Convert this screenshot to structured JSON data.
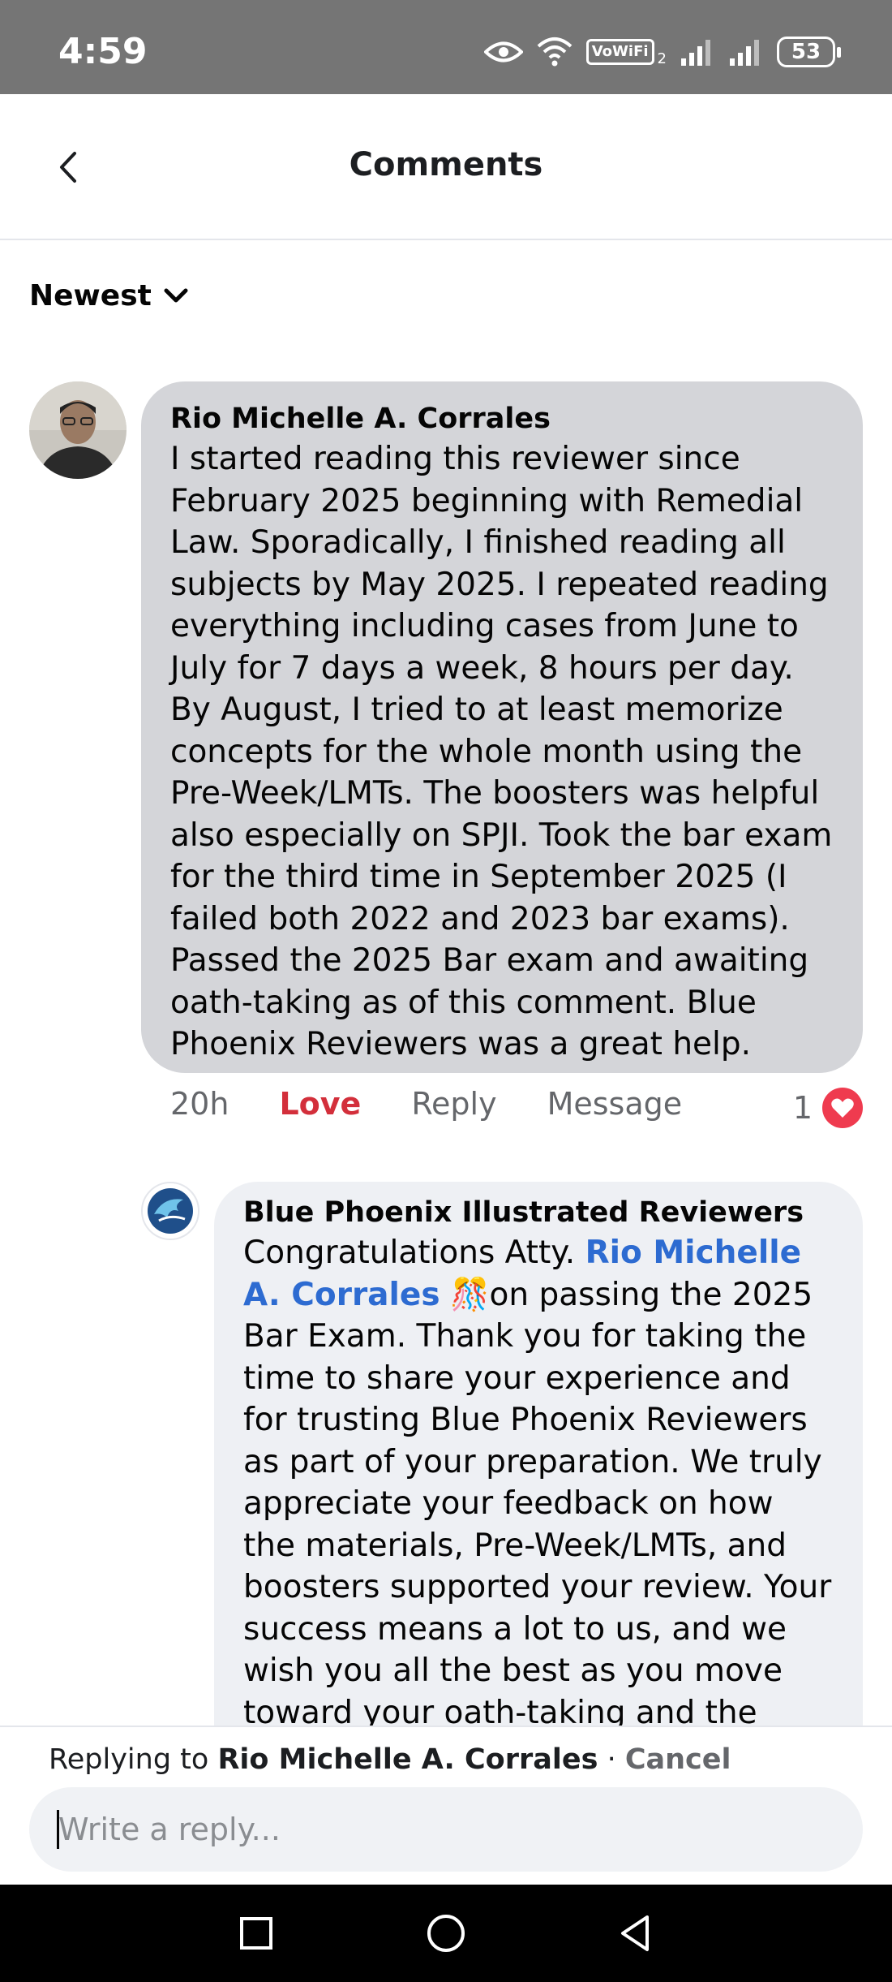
{
  "status_bar": {
    "time": "4:59",
    "vowifi": "VoWiFi",
    "vowifi_sub": "2",
    "battery": "53"
  },
  "header": {
    "title": "Comments"
  },
  "sort": {
    "label": "Newest"
  },
  "comments": [
    {
      "author": "Rio Michelle A. Corrales",
      "text": "I started reading this reviewer since February 2025 beginning with Remedial Law. Sporadically, I finished reading all subjects by May 2025. I repeated reading everything including cases from June to July for 7 days a week, 8 hours per day. By August, I tried to at least memorize concepts for the whole month using the Pre-Week/LMTs. The boosters was helpful also especially on SPJI. Took the bar exam for the third time in September 2025 (I failed both 2022 and 2023 bar exams). Passed the 2025 Bar exam and awaiting oath-taking as of this comment. Blue Phoenix Reviewers was a great help.",
      "time": "20h",
      "reaction_label": "Love",
      "reply_label": "Reply",
      "message_label": "Message",
      "reaction_count": "1"
    },
    {
      "author": "Blue Phoenix Illustrated Reviewers",
      "text_before": "Congratulations Atty. ",
      "mention": "Rio Michelle A. Corrales",
      "emoji": "🎊",
      "text_after": "on passing the 2025 Bar Exam. Thank you for taking the time to share your experience and for trusting Blue Phoenix Reviewers as part of your preparation. We truly appreciate your feedback on how the materials, Pre-Week/LMTs, and boosters supported your review. Your success means a lot to us, and we wish you all the best as you move toward your oath-taking and the"
    }
  ],
  "composer": {
    "replying_prefix": "Replying to ",
    "replying_name": "Rio Michelle A. Corrales",
    "separator": " · ",
    "cancel": "Cancel",
    "placeholder": "Write a reply..."
  },
  "colors": {
    "status_bar": "#757575",
    "bubble_primary": "#d4d5d9",
    "bubble_reply": "#eef0f4",
    "love": "#d32f3b",
    "mention": "#2d6bd1",
    "heart": "#ef3b4f"
  },
  "icons": {
    "eye": "eye-icon",
    "wifi": "wifi-icon",
    "signal": "signal-icon",
    "back": "back-arrow-icon",
    "chevron": "chevron-down-icon",
    "heart": "heart-icon",
    "recents": "recents-square-icon",
    "home": "home-circle-icon",
    "nav_back": "back-triangle-icon"
  }
}
